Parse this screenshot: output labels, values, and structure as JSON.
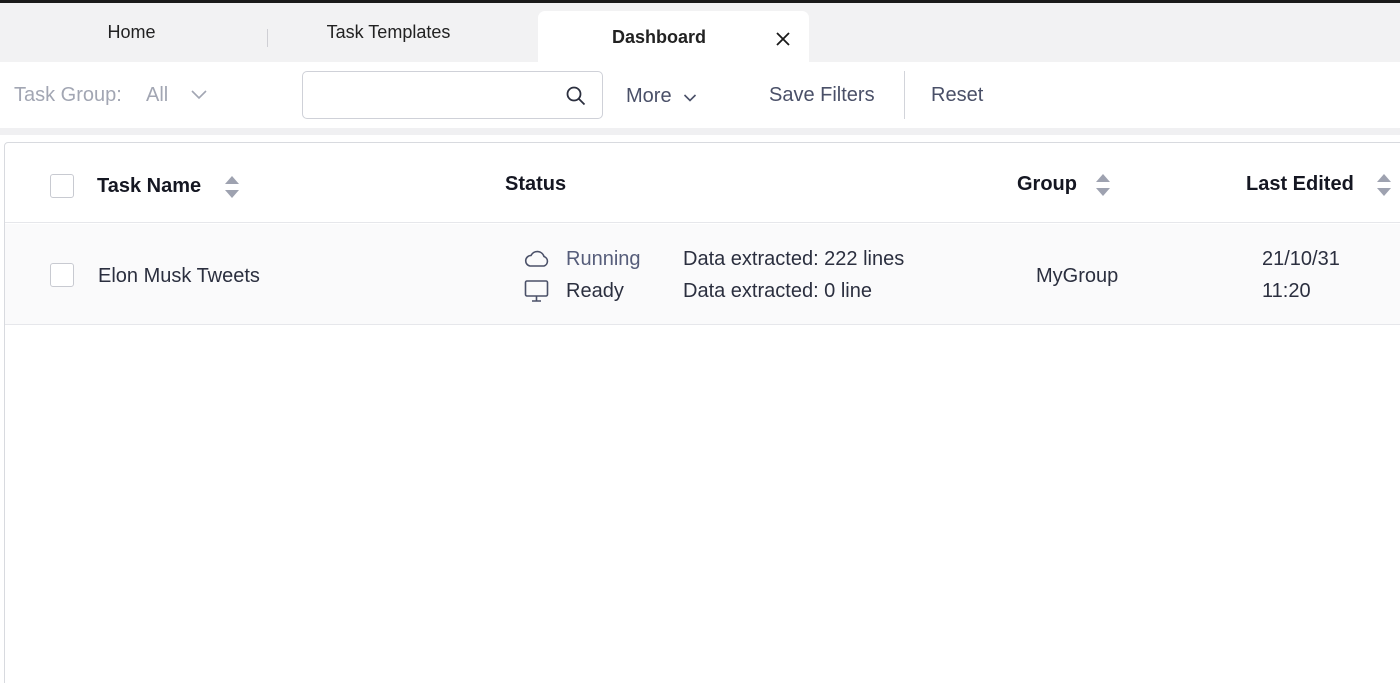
{
  "tabs": {
    "home": "Home",
    "templates": "Task Templates",
    "dashboard": "Dashboard"
  },
  "filters": {
    "task_group_label": "Task Group:",
    "task_group_value": "All",
    "search_placeholder": "",
    "more_label": "More",
    "save_filters_label": "Save Filters",
    "reset_label": "Reset"
  },
  "table": {
    "columns": {
      "task_name": "Task Name",
      "status": "Status",
      "group": "Group",
      "last_edited": "Last Edited"
    },
    "rows": [
      {
        "task_name": "Elon Musk Tweets",
        "cloud_status": "Running",
        "cloud_data": "Data extracted: 222 lines",
        "local_status": "Ready",
        "local_data": "Data extracted: 0 line",
        "group": "MyGroup",
        "date": "21/10/31",
        "time": "11:20"
      }
    ]
  },
  "icons": {
    "close": "close-icon",
    "chevron": "chevron-down-icon",
    "search": "search-icon",
    "sort": "sort-icon",
    "cloud": "cloud-icon",
    "monitor": "monitor-icon"
  },
  "colors": {
    "accent_text": "#4a5068",
    "muted": "#a2a6b3",
    "sort_arrow": "#9ea2b0"
  }
}
